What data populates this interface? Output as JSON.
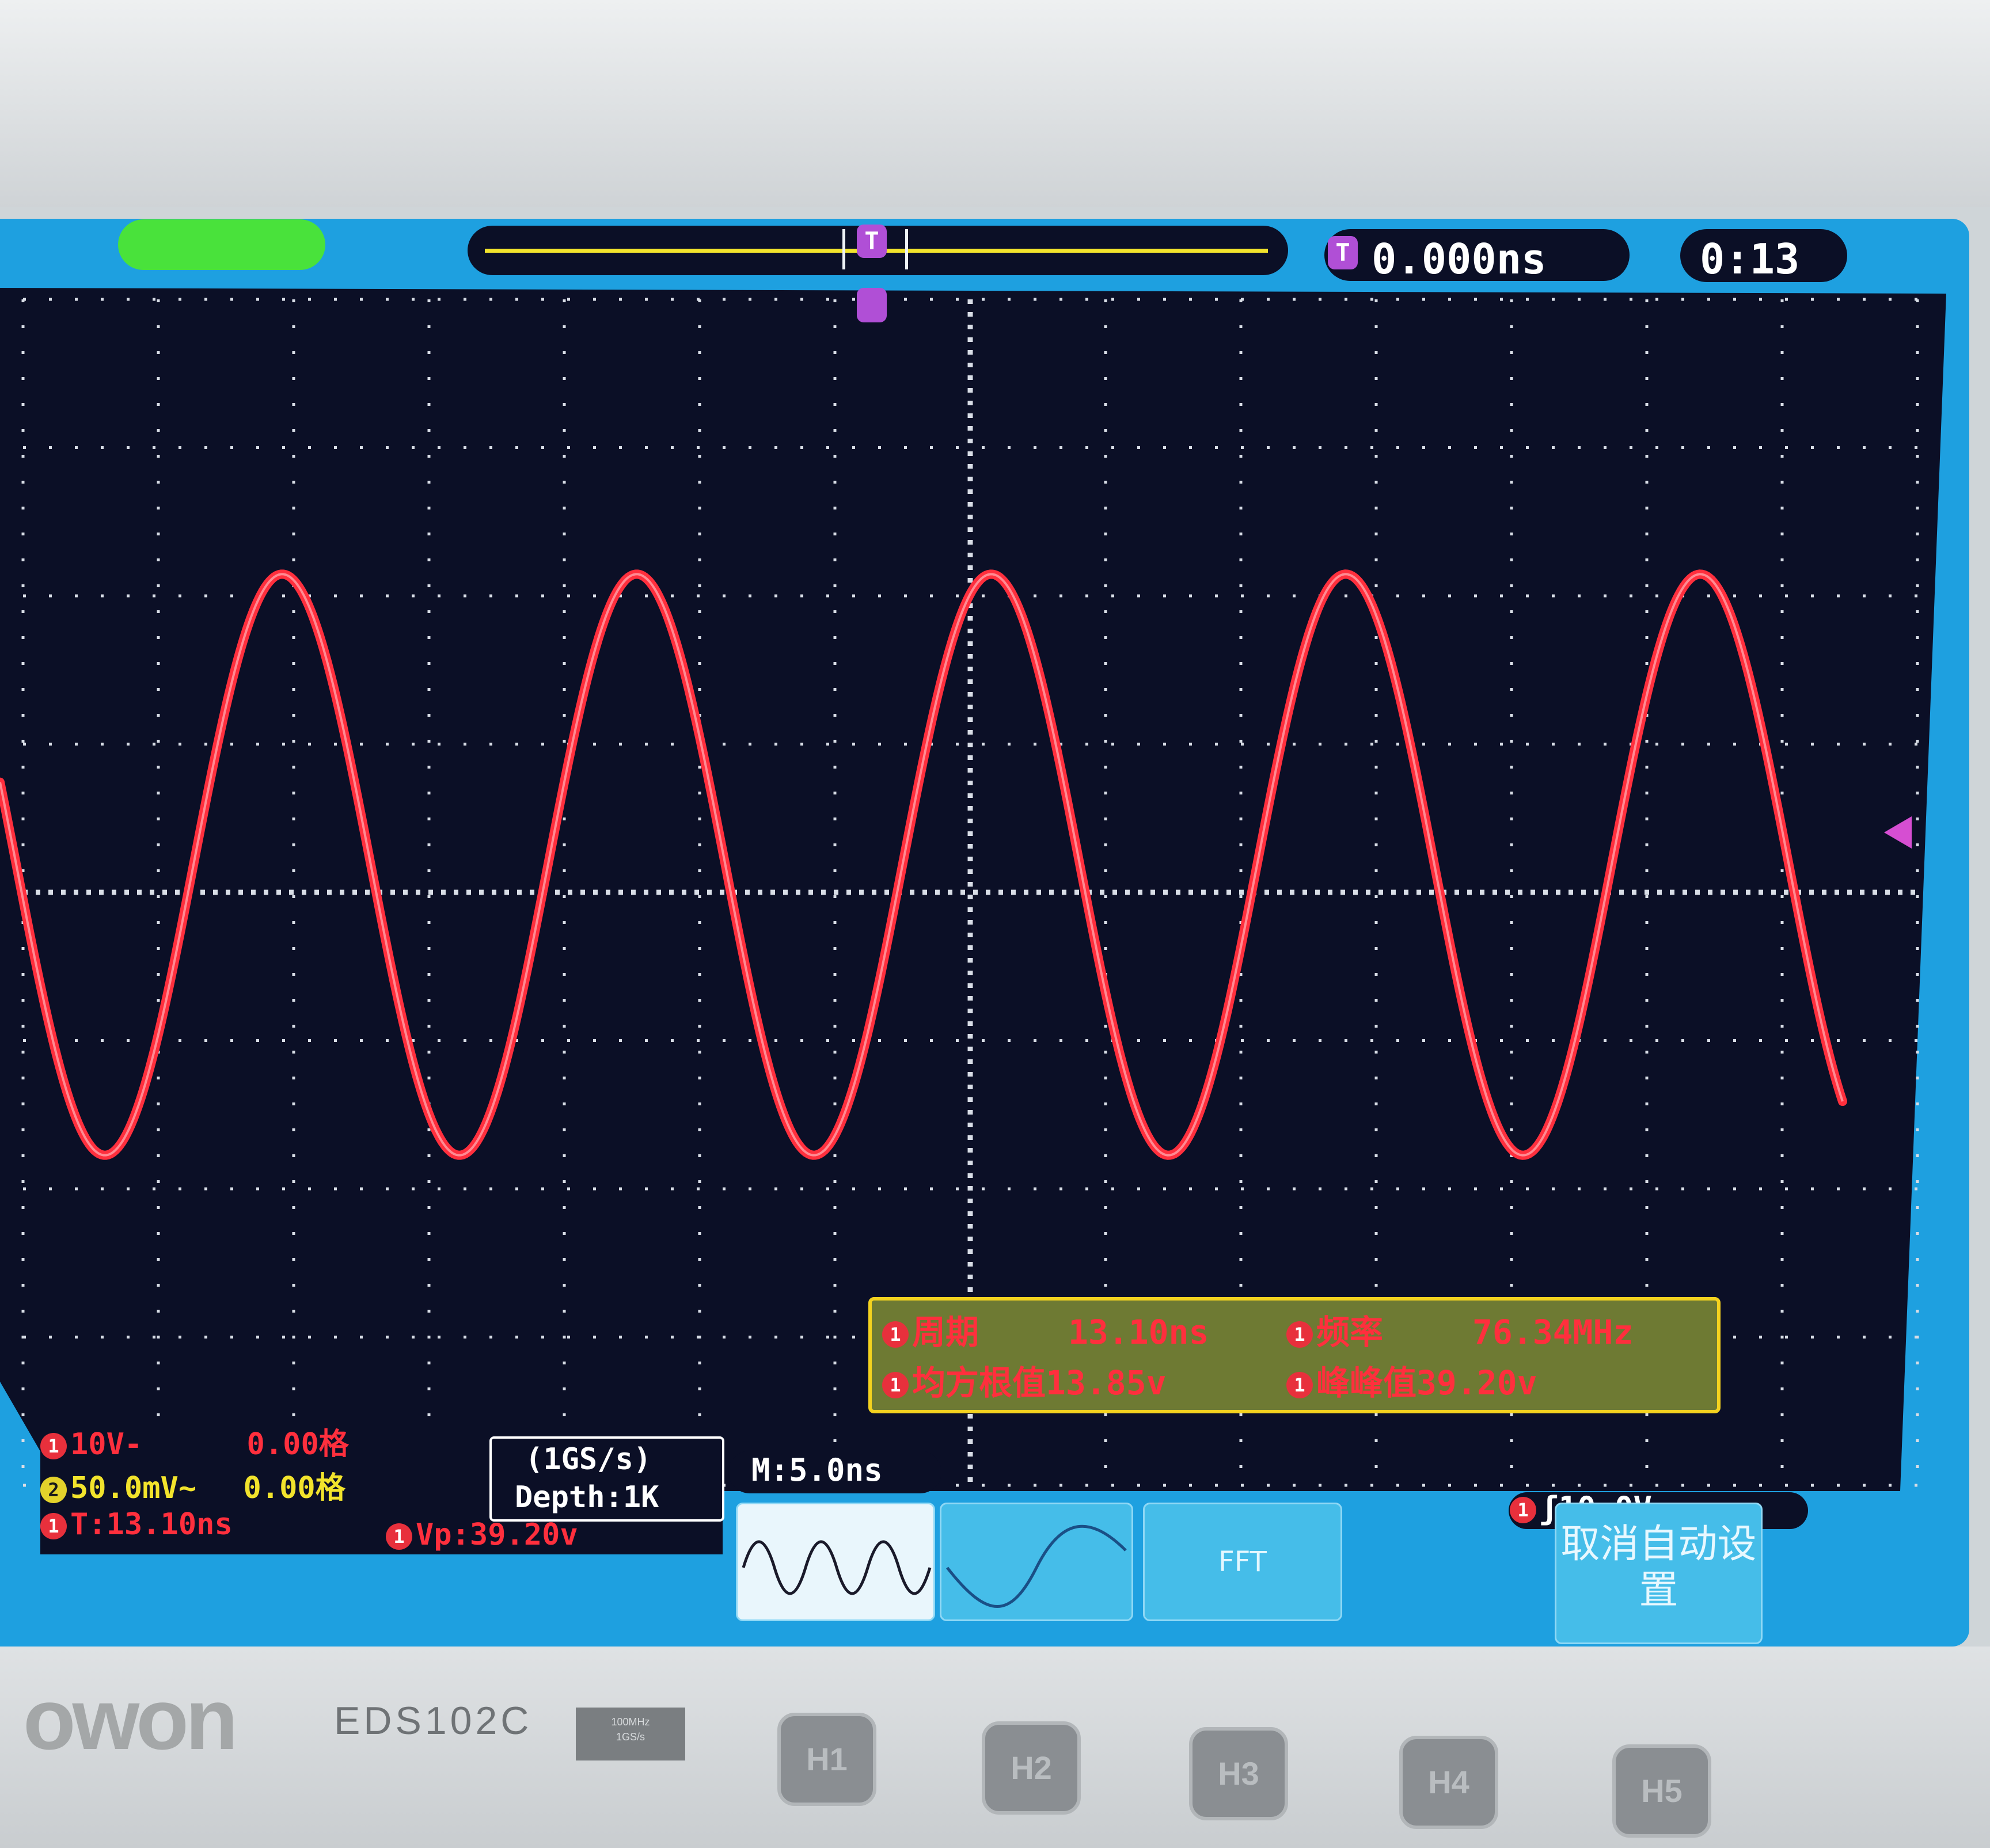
{
  "top_bar": {
    "trigger_marker": "T",
    "horizontal_position": "0.000ns",
    "clock": "0:13"
  },
  "measurements": {
    "period_label": "周期",
    "period_value": "13.10ns",
    "frequency_label": "频率",
    "frequency_value": "76.34MHz",
    "rms_label": "均方根值",
    "rms_value": "13.85v",
    "pkpk_label": "峰峰值",
    "pkpk_value": "39.20v"
  },
  "status": {
    "ch1_scale": "10V",
    "ch1_coupling": "-",
    "ch1_offset": "0.00格",
    "ch2_scale": "50.0mV",
    "ch2_coupling": "~",
    "ch2_offset": "0.00格",
    "period_short": "T:13.10ns",
    "vpp_short": "Vp:39.20v",
    "channel_1": "1",
    "channel_2": "2"
  },
  "acquisition": {
    "sample_rate": "(1GS/s)",
    "depth": "Depth:1K",
    "timebase": "M:5.0ns"
  },
  "trigger": {
    "level": "10.0V",
    "edge_symbol": "ʃ"
  },
  "softkeys": {
    "fft": "FFT",
    "cancel_autoset": "取消自动设置"
  },
  "device": {
    "brand": "owon",
    "model": "EDS102C",
    "spec_line1": "100MHz",
    "spec_line2": "1GS/s",
    "buttons": [
      "H1",
      "H2",
      "H3",
      "H4",
      "H5"
    ]
  },
  "colors": {
    "ch1_trace": "#ff2f3d",
    "ch2": "#f2e32c",
    "screen_bg": "#0b0f26",
    "frame": "#1ea0e0",
    "measurement_border": "#f4d21f"
  },
  "waveform": {
    "channel": 1,
    "type": "sine",
    "frequency_mhz": 76.34,
    "period_ns": 13.1,
    "peak_to_peak_v": 39.2,
    "volts_per_div": 10,
    "time_per_div_ns": 5
  }
}
